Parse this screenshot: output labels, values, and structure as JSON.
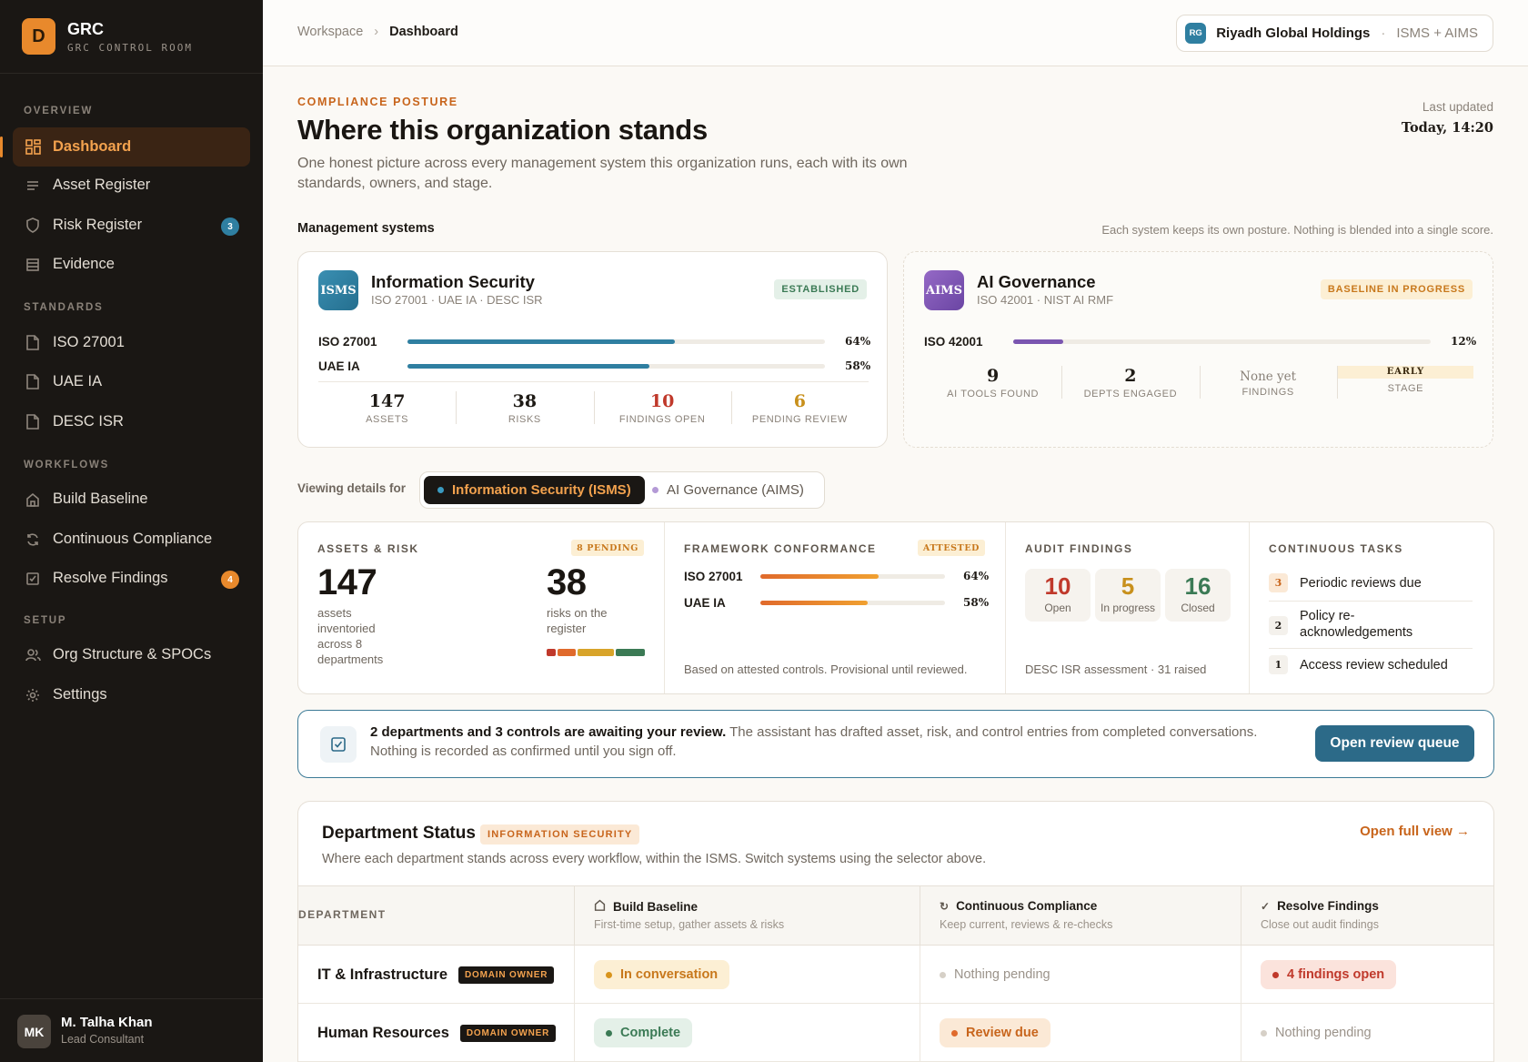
{
  "app": {
    "logo_letter": "D",
    "name": "GRC",
    "subtitle": "GRC CONTROL ROOM"
  },
  "sidebar": {
    "sections": [
      "OVERVIEW",
      "STANDARDS",
      "WORKFLOWS",
      "SETUP"
    ],
    "items": [
      {
        "label": "Dashboard",
        "icon": "grid-icon",
        "active": true
      },
      {
        "label": "Asset Register",
        "icon": "list-icon"
      },
      {
        "label": "Risk Register",
        "icon": "shield-icon",
        "badge": "3"
      },
      {
        "label": "Evidence",
        "icon": "archive-icon"
      },
      {
        "label": "ISO 27001",
        "icon": "document-icon"
      },
      {
        "label": "UAE IA",
        "icon": "document-icon"
      },
      {
        "label": "DESC ISR",
        "icon": "document-icon"
      },
      {
        "label": "Build Baseline",
        "icon": "home-icon"
      },
      {
        "label": "Continuous Compliance",
        "icon": "refresh-icon"
      },
      {
        "label": "Resolve Findings",
        "icon": "checkbox-icon",
        "badge": "4"
      },
      {
        "label": "Org Structure & SPOCs",
        "icon": "users-icon"
      },
      {
        "label": "Settings",
        "icon": "gear-icon"
      }
    ],
    "user": {
      "initials": "MK",
      "name": "M. Talha Khan",
      "role": "Lead Consultant"
    }
  },
  "topbar": {
    "breadcrumb": [
      "Workspace",
      "Dashboard"
    ],
    "org": {
      "initials": "RG",
      "name": "Riyadh Global Holdings",
      "systems": "ISMS + AIMS"
    }
  },
  "header": {
    "eyebrow": "COMPLIANCE POSTURE",
    "title": "Where this organization stands",
    "lede": "One honest picture across every management system this organization runs, each with its own standards, owners, and stage.",
    "updated_label": "Last updated",
    "updated_value": "Today, 14:20"
  },
  "systems_section": {
    "title": "Management systems",
    "note": "Each system keeps its own posture. Nothing is blended into a single score."
  },
  "isms": {
    "logo": "ISMS",
    "name": "Information Security",
    "standards": "ISO 27001 · UAE IA · DESC ISR",
    "tag": "ESTABLISHED",
    "bars": [
      {
        "label": "ISO 27001",
        "value": 64,
        "pct": "64%"
      },
      {
        "label": "UAE IA",
        "value": 58,
        "pct": "58%"
      }
    ],
    "stats": [
      {
        "value": "147",
        "label": "ASSETS"
      },
      {
        "value": "38",
        "label": "RISKS"
      },
      {
        "value": "10",
        "label": "FINDINGS OPEN"
      },
      {
        "value": "6",
        "label": "PENDING REVIEW"
      }
    ]
  },
  "aims": {
    "logo": "AIMS",
    "name": "AI Governance",
    "standards": "ISO 42001 · NIST AI RMF",
    "tag": "BASELINE IN PROGRESS",
    "bars": [
      {
        "label": "ISO 42001",
        "value": 12,
        "pct": "12%"
      }
    ],
    "stats": [
      {
        "value": "9",
        "label": "AI TOOLS FOUND"
      },
      {
        "value": "2",
        "label": "DEPTS ENGAGED"
      },
      {
        "value": "None yet",
        "label": "FINDINGS"
      },
      {
        "value": "EARLY",
        "label": "STAGE"
      }
    ]
  },
  "view": {
    "label": "Viewing details for",
    "options": [
      "Information Security (ISMS)",
      "AI Governance (AIMS)"
    ]
  },
  "summary": {
    "assets_risk": {
      "title": "ASSETS & RISK",
      "tag": "8 PENDING",
      "assets": "147",
      "assets_sub": "assets inventoried across 8 departments",
      "risks": "38",
      "risks_sub": "risks on the register"
    },
    "framework": {
      "title": "FRAMEWORK CONFORMANCE",
      "tag": "ATTESTED",
      "bars": [
        {
          "label": "ISO 27001",
          "value": 64,
          "pct": "64%"
        },
        {
          "label": "UAE IA",
          "value": 58,
          "pct": "58%"
        }
      ],
      "note": "Based on attested controls. Provisional until reviewed."
    },
    "audit": {
      "title": "AUDIT FINDINGS",
      "boxes": [
        {
          "n": "10",
          "l": "Open"
        },
        {
          "n": "5",
          "l": "In progress"
        },
        {
          "n": "16",
          "l": "Closed"
        }
      ],
      "note": "DESC ISR assessment · 31 raised"
    },
    "tasks": {
      "title": "CONTINUOUS TASKS",
      "items": [
        {
          "n": "3",
          "l": "Periodic reviews due"
        },
        {
          "n": "2",
          "l": "Policy re-acknowledgements"
        },
        {
          "n": "1",
          "l": "Access review scheduled"
        }
      ]
    }
  },
  "alert": {
    "bold": "2 departments and 3 controls are awaiting your review.",
    "text": " The assistant has drafted asset, risk, and control entries from completed conversations. Nothing is recorded as confirmed until you sign off.",
    "button": "Open review queue"
  },
  "departments": {
    "title": "Department Status",
    "tag": "INFORMATION SECURITY",
    "link": "Open full view →",
    "subtitle": "Where each department stands across every workflow, within the ISMS. Switch systems using the selector above.",
    "columns": [
      {
        "title": "DEPARTMENT"
      },
      {
        "title": "Build Baseline",
        "sub": "First-time setup, gather assets & risks"
      },
      {
        "title": "Continuous Compliance",
        "sub": "Keep current, reviews & re-checks"
      },
      {
        "title": "Resolve Findings",
        "sub": "Close out audit findings"
      }
    ],
    "rows": [
      {
        "name": "IT & Infrastructure",
        "owner": "DOMAIN OWNER",
        "baseline": "In conversation",
        "compliance": "Nothing pending",
        "findings": "4 findings open"
      },
      {
        "name": "Human Resources",
        "owner": "DOMAIN OWNER",
        "baseline": "Complete",
        "compliance": "Review due",
        "findings": "Nothing pending"
      }
    ]
  },
  "colors": {
    "accent": "#e8892c",
    "brand_blue": "#2c6a88",
    "isms": "#2f7fa1",
    "aims": "#7a55b0",
    "red": "#c0392b",
    "amber": "#c8901c",
    "green": "#3b7a55"
  }
}
